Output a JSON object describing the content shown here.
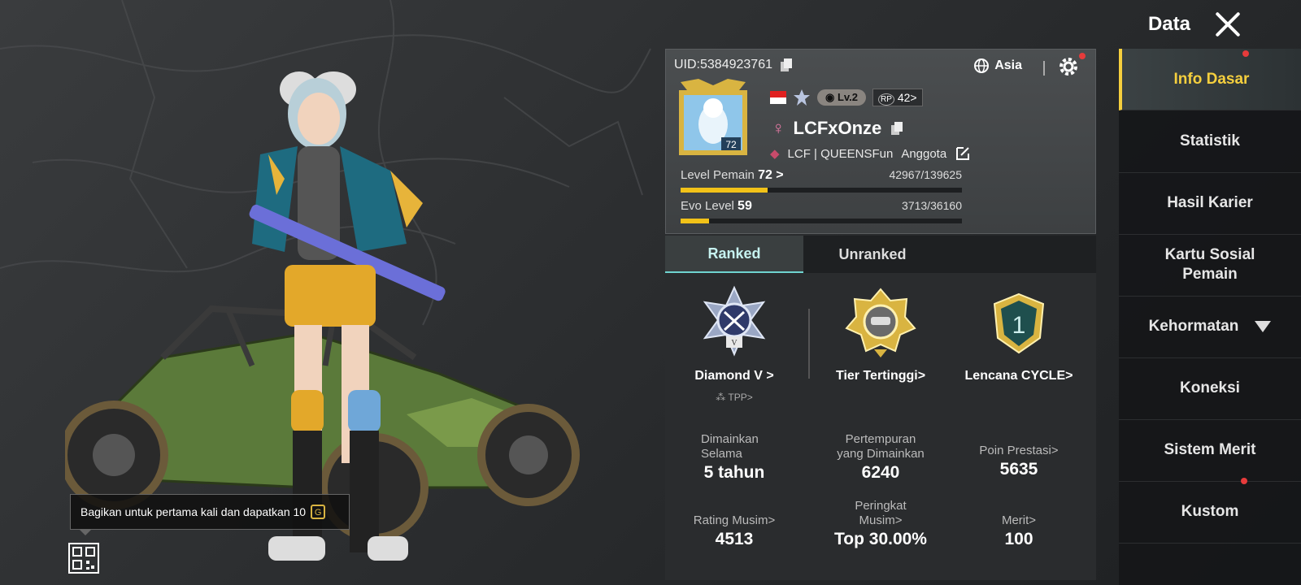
{
  "header": {
    "title": "Data"
  },
  "profile": {
    "uid": "UID:5384923761",
    "region": "Asia",
    "level_badge": "Lv.2",
    "rp": "42>",
    "avatar_level": "72",
    "name": "LCFxOnze",
    "clan": "LCF | QUEENSFun",
    "clan_role": "Anggota",
    "player_level_label": "Level Pemain",
    "player_level": "72 >",
    "player_xp": "42967/139625",
    "player_xp_progress": 0.31,
    "evo_label": "Evo Level",
    "evo_level": "59",
    "evo_xp": "3713/36160",
    "evo_progress": 0.1
  },
  "tabs": [
    {
      "label": "Ranked"
    },
    {
      "label": "Unranked"
    }
  ],
  "badges": {
    "tier": {
      "label": "Diamond V >",
      "sub": "TPP>",
      "roman": "V"
    },
    "highest": {
      "label": "Tier Tertinggi>"
    },
    "cycle": {
      "label": "Lencana CYCLE>",
      "number": "1"
    }
  },
  "stats": {
    "played_for": {
      "label": "Dimainkan Selama",
      "value": "5 tahun"
    },
    "matches": {
      "label": "Pertempuran yang Dimainkan",
      "value": "6240"
    },
    "achievement": {
      "label": "Poin Prestasi>",
      "value": "5635"
    },
    "season_rating": {
      "label": "Rating Musim>",
      "value": "4513"
    },
    "season_rank": {
      "label": "Peringkat Musim>",
      "value": "Top 30.00%"
    },
    "merit": {
      "label": "Merit>",
      "value": "100"
    }
  },
  "share_tip": {
    "text": "Bagikan untuk pertama kali dan dapatkan 10",
    "coin": "G"
  },
  "side_menu": [
    {
      "label": "Info Dasar"
    },
    {
      "label": "Statistik"
    },
    {
      "label": "Hasil Karier"
    },
    {
      "label": "Kartu Sosial Pemain"
    },
    {
      "label": "Kehormatan"
    },
    {
      "label": "Koneksi"
    },
    {
      "label": "Sistem Merit"
    },
    {
      "label": "Kustom"
    }
  ],
  "colors": {
    "accent_yellow": "#f5cf3e",
    "tab_active": "#6fd4d0",
    "progress": "#f2c218"
  }
}
